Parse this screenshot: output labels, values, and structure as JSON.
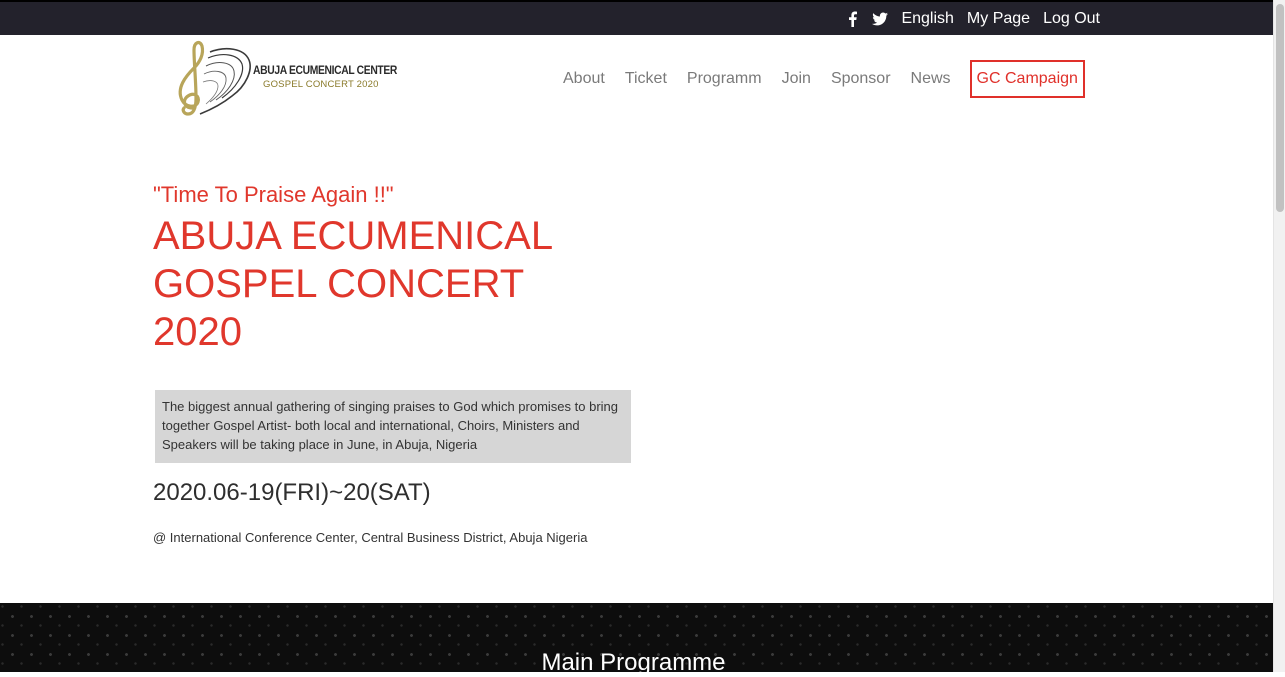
{
  "topbar": {
    "icons": [
      "facebook-icon",
      "twitter-icon"
    ],
    "links": [
      "English",
      "My Page",
      "Log Out"
    ]
  },
  "logo": {
    "line1": "ABUJA ECUMENICAL CENTER",
    "line2": "GOSPEL CONCERT 2020"
  },
  "nav": {
    "items": [
      "About",
      "Ticket",
      "Programm",
      "Join",
      "Sponsor",
      "News"
    ],
    "cta": "GC Campaign"
  },
  "hero": {
    "tagline": "\"Time To Praise Again !!\"",
    "title": "ABUJA ECUMENICAL GOSPEL CONCERT 2020",
    "description": "The biggest annual gathering of singing praises to God which promises to bring together Gospel Artist- both local and international, Choirs, Ministers and Speakers will be taking place in June, in Abuja, Nigeria",
    "date": "2020.06-19(FRI)~20(SAT)",
    "venue": "@ International Conference Center, Central Business District, Abuja Nigeria"
  },
  "programme": {
    "title": "Main Programme"
  },
  "colors": {
    "accent": "#e0372c",
    "topbar": "#23222c",
    "nav_text": "#7a7a7a",
    "desc_bg": "#d6d6d6",
    "logo_gold": "#b8a55a"
  }
}
